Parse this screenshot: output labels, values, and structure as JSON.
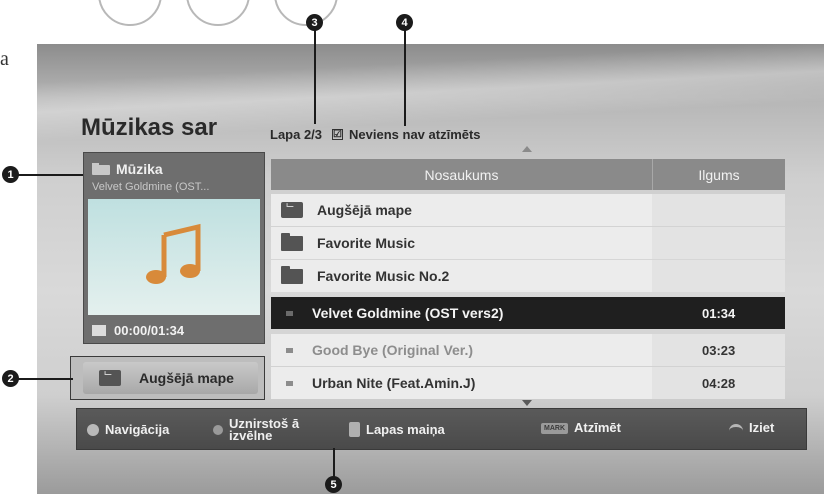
{
  "stray_text": "a",
  "header": {
    "title": "Mūzikas sar",
    "page_indicator": "Lapa 2/3",
    "mark_checkbox_symbol": "☑",
    "mark_status": "Neviens nav atzīmēts"
  },
  "preview": {
    "category": "Mūzika",
    "track_title": "Velvet Goldmine (OST...",
    "time": "00:00/01:34"
  },
  "up_folder_button": {
    "label": "Augšējā mape"
  },
  "list": {
    "columns": [
      "Nosaukums",
      "Ilgums"
    ],
    "rows": [
      {
        "type": "up-folder",
        "name": "Augšējā mape",
        "duration": ""
      },
      {
        "type": "folder",
        "name": "Favorite Music",
        "duration": ""
      },
      {
        "type": "folder",
        "name": "Favorite Music No.2",
        "duration": ""
      },
      {
        "type": "track",
        "name": "Velvet Goldmine (OST vers2)",
        "duration": "01:34",
        "selected": true
      },
      {
        "type": "track",
        "name": "Good Bye (Original Ver.)",
        "duration": "03:23",
        "faded": true
      },
      {
        "type": "track",
        "name": "Urban Nite (Feat.Amin.J)",
        "duration": "04:28"
      }
    ]
  },
  "helpbar": {
    "navigation": "Navigācija",
    "popup_line1": "Uznirstoš ā",
    "popup_line2": "izvēlne",
    "page_change": "Lapas maiņa",
    "mark_key": "MARK",
    "mark": "Atzīmēt",
    "exit": "Iziet"
  },
  "callouts": [
    "1",
    "2",
    "3",
    "4",
    "5"
  ],
  "colors": {
    "selected_row": "#1f1f1f",
    "header_row": "#8a8a8a",
    "helpbar": "#4f4f4f"
  }
}
